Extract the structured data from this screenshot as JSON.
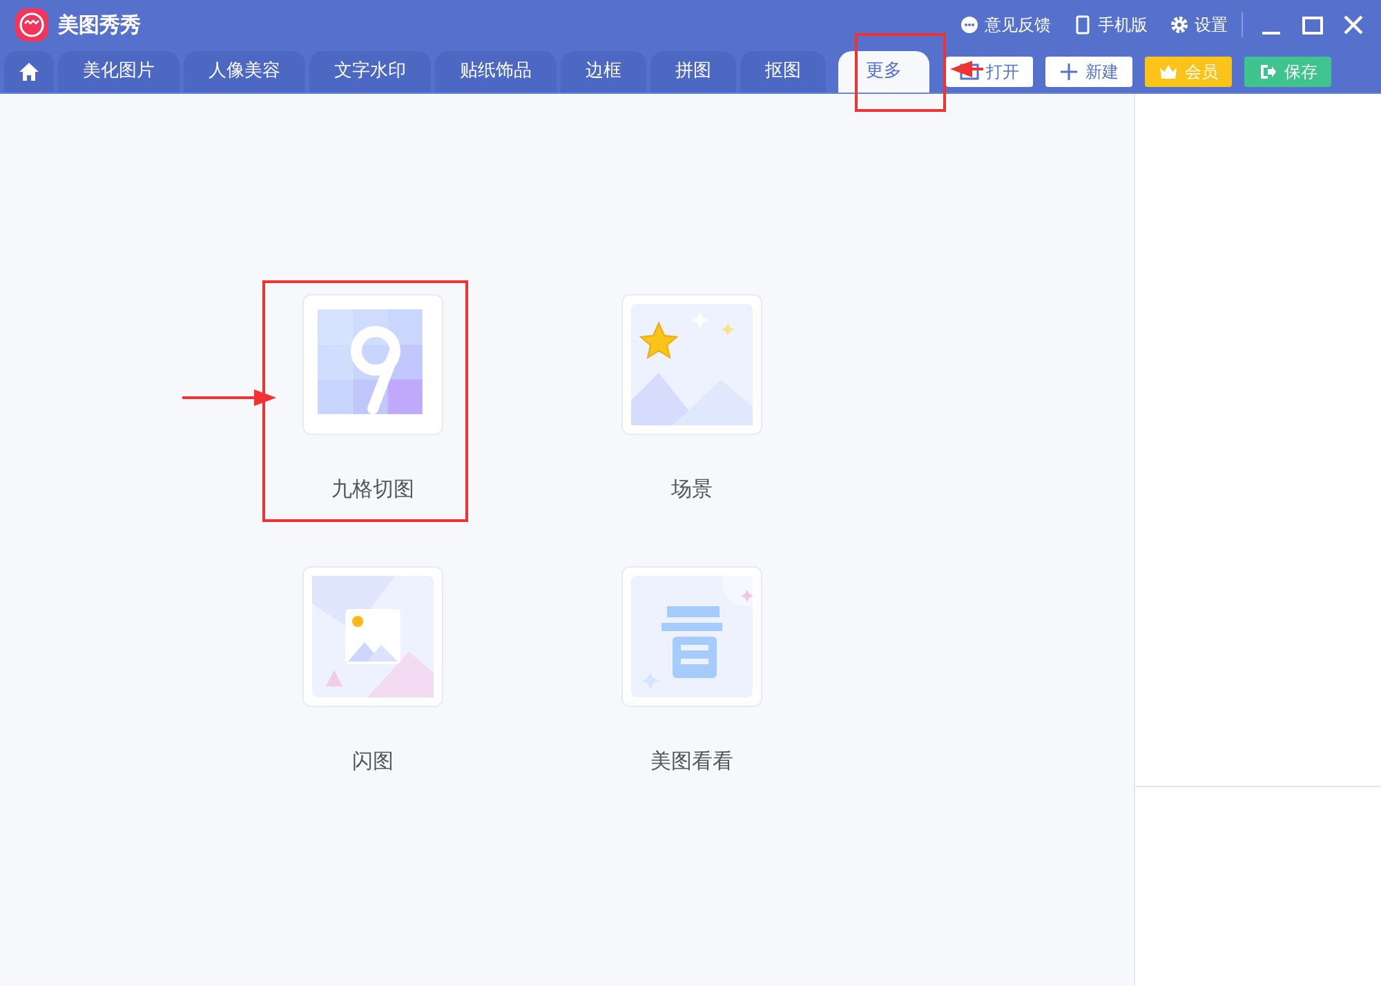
{
  "app": {
    "title": "美图秀秀"
  },
  "header_links": [
    {
      "kind": "feedback",
      "label": "意见反馈"
    },
    {
      "kind": "phone",
      "label": "手机版"
    },
    {
      "kind": "settings",
      "label": "设置"
    }
  ],
  "tabs": [
    {
      "kind": "home",
      "selected": false
    },
    {
      "label": "美化图片",
      "selected": false
    },
    {
      "label": "人像美容",
      "selected": false
    },
    {
      "label": "文字水印",
      "selected": false
    },
    {
      "label": "贴纸饰品",
      "selected": false
    },
    {
      "label": "边框",
      "selected": false
    },
    {
      "label": "拼图",
      "selected": false
    },
    {
      "label": "抠图",
      "selected": false
    },
    {
      "label": "更多",
      "selected": true
    }
  ],
  "actions": [
    {
      "kind": "open",
      "label": "打开"
    },
    {
      "kind": "new",
      "label": "新建"
    },
    {
      "kind": "vip",
      "label": "会员"
    },
    {
      "kind": "save",
      "label": "保存"
    }
  ],
  "tools": [
    {
      "kind": "grid9",
      "label": "九格切图"
    },
    {
      "kind": "scene",
      "label": "场景"
    },
    {
      "kind": "flash",
      "label": "闪图"
    },
    {
      "kind": "look",
      "label": "美图看看"
    }
  ]
}
